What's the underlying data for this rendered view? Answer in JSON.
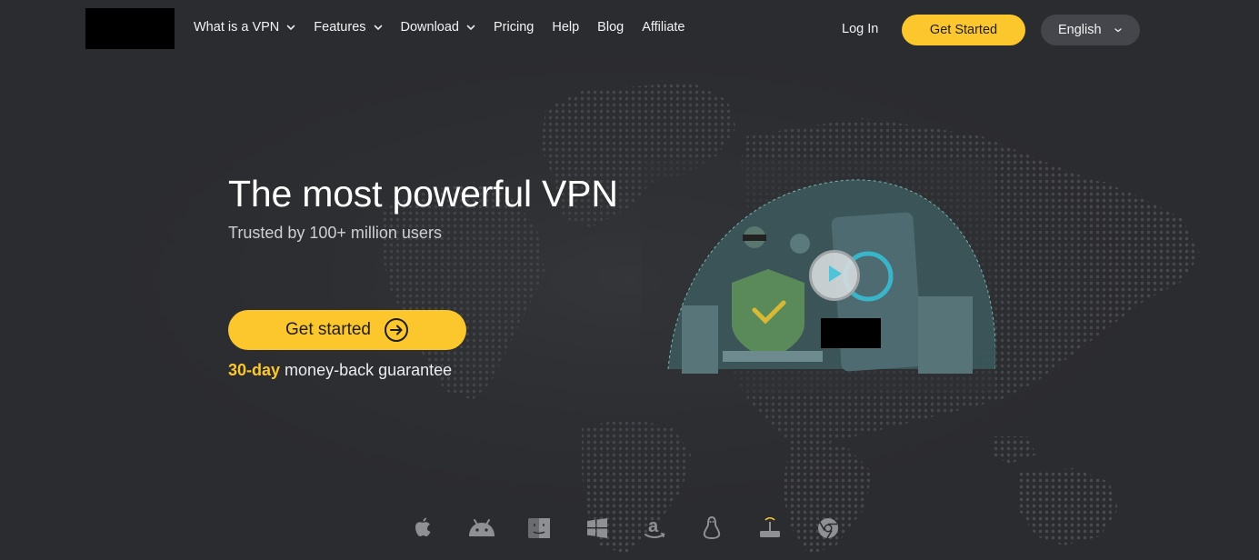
{
  "header": {
    "logo": "site-logo",
    "nav": [
      {
        "label": "What is a VPN",
        "dropdown": true
      },
      {
        "label": "Features",
        "dropdown": true
      },
      {
        "label": "Download",
        "dropdown": true
      },
      {
        "label": "Pricing",
        "dropdown": false
      },
      {
        "label": "Help",
        "dropdown": false
      },
      {
        "label": "Blog",
        "dropdown": false
      },
      {
        "label": "Affiliate",
        "dropdown": false
      }
    ],
    "login_label": "Log In",
    "get_started_label": "Get Started",
    "language": "English"
  },
  "hero": {
    "title": "The most powerful VPN",
    "subtitle": "Trusted by 100+ million users",
    "cta_label": "Get started",
    "guarantee_highlight": "30-day",
    "guarantee_text": " money-back guarantee"
  },
  "platforms": [
    "apple-icon",
    "android-icon",
    "finder-icon",
    "windows-icon",
    "amazon-icon",
    "linux-icon",
    "router-icon",
    "chrome-icon"
  ],
  "colors": {
    "background": "#2b2c30",
    "accent": "#fcc62d",
    "language_button": "#45464b"
  }
}
